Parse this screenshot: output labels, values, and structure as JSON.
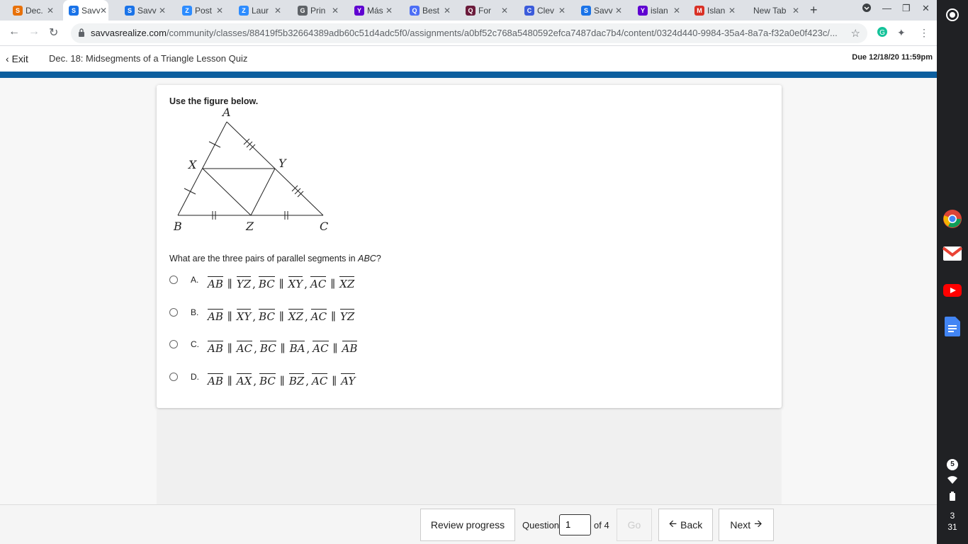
{
  "browser": {
    "tabs": [
      {
        "label": "Dec.",
        "icon": "s",
        "color": "#e8710a",
        "active": false
      },
      {
        "label": "Savv",
        "icon": "s",
        "color": "#1a73e8",
        "active": true
      },
      {
        "label": "Savv",
        "icon": "s",
        "color": "#1a73e8",
        "active": false
      },
      {
        "label": "Post",
        "icon": "z",
        "color": "#2d8cff",
        "active": false
      },
      {
        "label": "Laur",
        "icon": "z",
        "color": "#2d8cff",
        "active": false
      },
      {
        "label": "Prin",
        "icon": "g",
        "color": "#5f6368",
        "active": false
      },
      {
        "label": "Más",
        "icon": "y",
        "color": "#5f01d1",
        "active": false
      },
      {
        "label": "Best",
        "icon": "q",
        "color": "#4c6ef5",
        "active": false
      },
      {
        "label": "For",
        "icon": "q",
        "color": "#6b1b3b",
        "active": false
      },
      {
        "label": "Clev",
        "icon": "c",
        "color": "#3b5bdb",
        "active": false
      },
      {
        "label": "Savv",
        "icon": "s",
        "color": "#1a73e8",
        "active": false
      },
      {
        "label": "islan",
        "icon": "y",
        "color": "#5f01d1",
        "active": false
      },
      {
        "label": "Islan",
        "icon": "m",
        "color": "#d93025",
        "active": false
      },
      {
        "label": "New Tab",
        "icon": "",
        "color": "",
        "active": false
      }
    ],
    "url_host": "savvasrealize.com",
    "url_path": "/community/classes/88419f5b32664389adb60c51d4adc5f0/assignments/a0bf52c768a5480592efca7487dac7b4/content/0324d440-9984-35a4-8a7a-f32a0e0f423c/..."
  },
  "header": {
    "exit_label": "Exit",
    "quiz_title": "Dec. 18: Midsegments of a Triangle Lesson Quiz",
    "due": "Due 12/18/20 11:59pm"
  },
  "question": {
    "instruction": "Use the figure below.",
    "figure_labels": {
      "A": "A",
      "B": "B",
      "C": "C",
      "X": "X",
      "Y": "Y",
      "Z": "Z"
    },
    "prompt_before": "What are the three pairs of parallel segments in ",
    "prompt_italic": "ABC",
    "prompt_after": "?",
    "choices": [
      {
        "letter": "A.",
        "pairs": [
          [
            "AB",
            "YZ"
          ],
          [
            "BC",
            "XY"
          ],
          [
            "AC",
            "XZ"
          ]
        ]
      },
      {
        "letter": "B.",
        "pairs": [
          [
            "AB",
            "XY"
          ],
          [
            "BC",
            "XZ"
          ],
          [
            "AC",
            "YZ"
          ]
        ]
      },
      {
        "letter": "C.",
        "pairs": [
          [
            "AB",
            "AC"
          ],
          [
            "BC",
            "BA"
          ],
          [
            "AC",
            "AB"
          ]
        ]
      },
      {
        "letter": "D.",
        "pairs": [
          [
            "AB",
            "AX"
          ],
          [
            "BC",
            "BZ"
          ],
          [
            "AC",
            "AY"
          ]
        ]
      }
    ]
  },
  "footer": {
    "review_label": "Review progress",
    "question_label": "Question",
    "question_value": "1",
    "of_label": "of 4",
    "go_label": "Go",
    "back_label": "Back",
    "next_label": "Next"
  },
  "shelf": {
    "notification_count": "5",
    "time_hour": "3",
    "time_min": "31"
  }
}
